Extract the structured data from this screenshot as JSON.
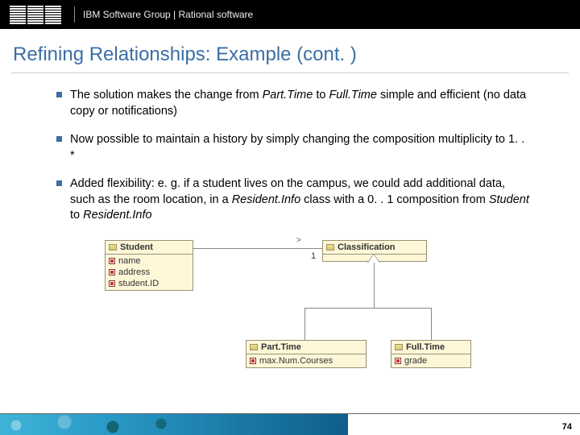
{
  "header": {
    "org": "IBM Software Group | Rational software"
  },
  "title": "Refining Relationships: Example (cont. )",
  "bullets": [
    {
      "pre": "The solution makes the change from ",
      "em1": "Part.Time",
      "mid": " to ",
      "em2": "Full.Time",
      "post": " simple and efficient (no data copy or notifications)"
    },
    {
      "pre": "Now possible to maintain a history by simply changing the composition multiplicity to 1. . *",
      "em1": "",
      "mid": "",
      "em2": "",
      "post": ""
    },
    {
      "pre": "Added flexibility: e. g. if a student lives on the campus, we could add additional data, such as the room location, in a ",
      "em1": "Resident.Info",
      "mid": " class with a 0. . 1 composition from ",
      "em2": "Student",
      "post2pre": " to ",
      "em3": "Resident.Info",
      "post": ""
    }
  ],
  "diagram": {
    "student": {
      "name": "Student",
      "attrs": [
        "name",
        "address",
        "student.ID"
      ]
    },
    "classification": {
      "name": "Classification"
    },
    "parttime": {
      "name": "Part.Time",
      "attrs": [
        "max.Num.Courses"
      ]
    },
    "fulltime": {
      "name": "Full.Time",
      "attrs": [
        "grade"
      ]
    },
    "assoc": {
      "mult": "1",
      "dir": ">"
    }
  },
  "page": "74"
}
